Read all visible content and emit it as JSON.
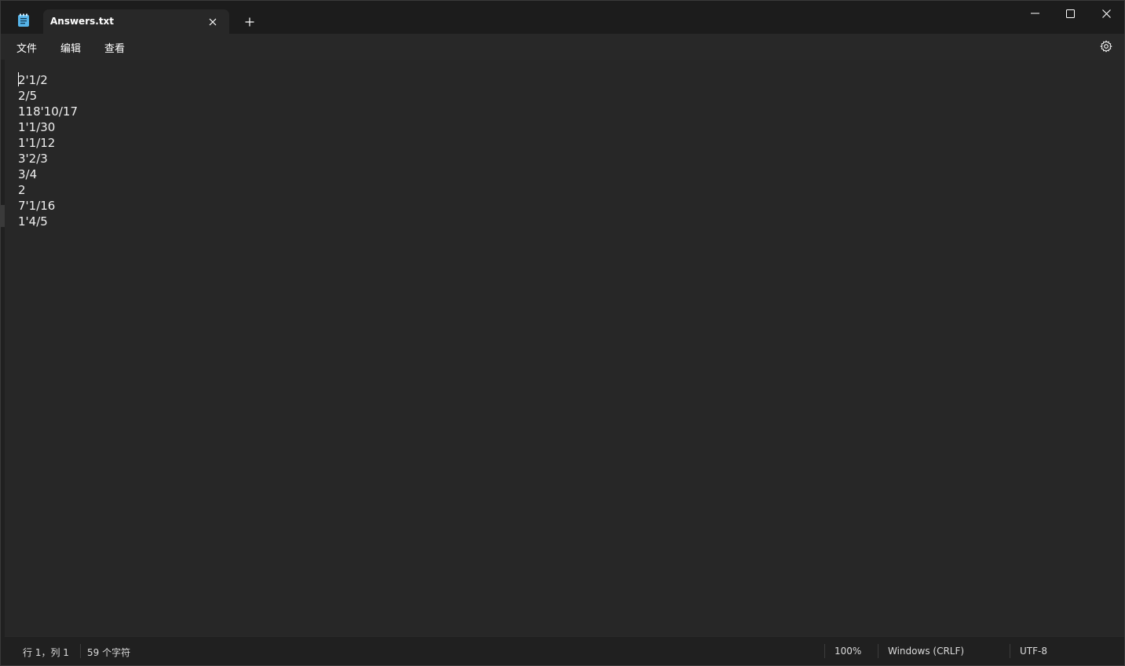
{
  "window": {
    "tab_title": "Answers.txt",
    "accent_color": "#56b4e9"
  },
  "menu": {
    "file": "文件",
    "edit": "编辑",
    "view": "查看"
  },
  "document": {
    "lines": [
      "2'1/2",
      "2/5",
      "118'10/17",
      "1'1/30",
      "1'1/12",
      "3'2/3",
      "3/4",
      "2",
      "7'1/16",
      "1'4/5"
    ]
  },
  "status": {
    "position": "行 1，列 1",
    "char_count": "59 个字符",
    "zoom": "100%",
    "line_ending": "Windows (CRLF)",
    "encoding": "UTF-8"
  },
  "icons": {
    "app": "notepad-icon",
    "close_tab": "close-icon",
    "new_tab": "plus-icon",
    "minimize": "minimize-icon",
    "maximize": "maximize-icon",
    "close_window": "close-icon",
    "settings": "gear-icon"
  }
}
